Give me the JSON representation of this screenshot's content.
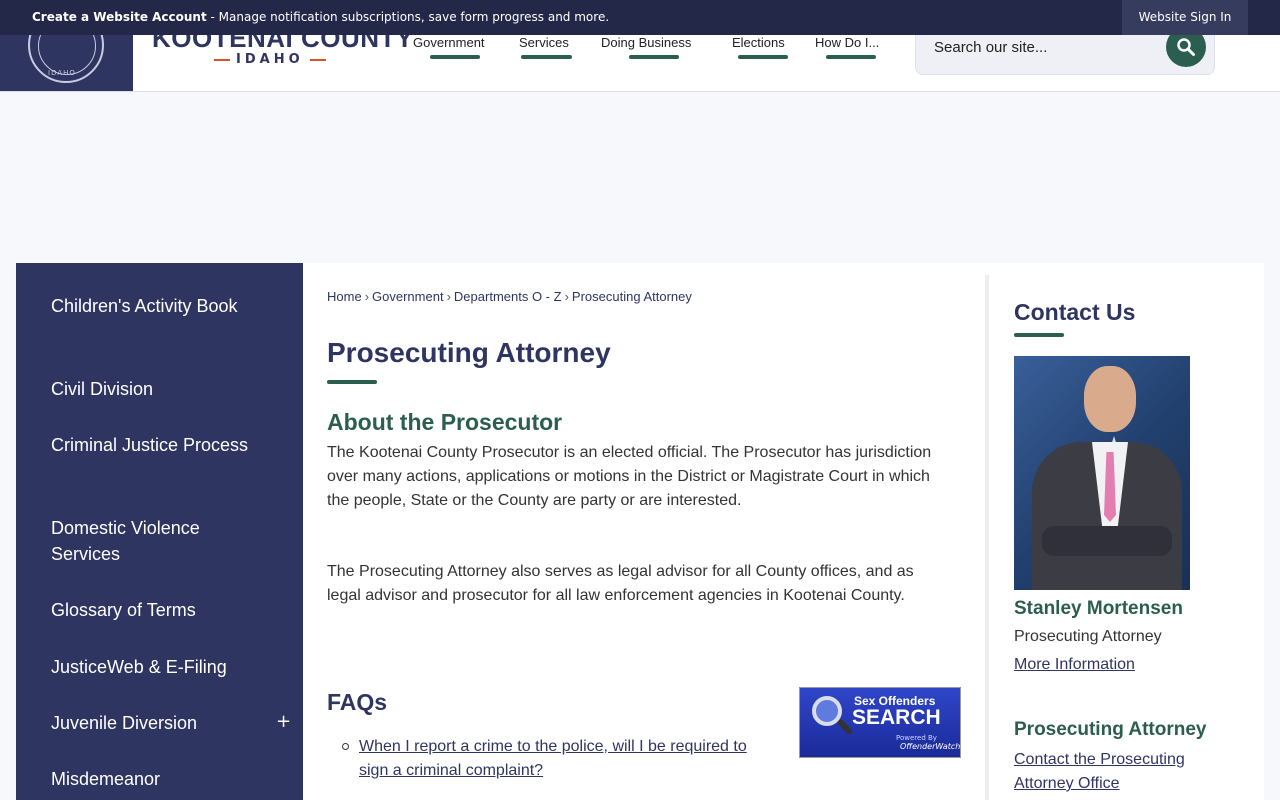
{
  "topbar": {
    "account_link": "Create a Website Account",
    "account_desc": " - Manage notification subscriptions, save form progress and more.",
    "signin_label": "Website Sign In"
  },
  "header": {
    "seal_text": "IDAHO",
    "logo_title": "KOOTENAI COUNTY",
    "logo_subtitle": "IDAHO",
    "nav": [
      {
        "label": "Government"
      },
      {
        "label": "Services"
      },
      {
        "label": "Doing Business"
      },
      {
        "label": "Elections"
      },
      {
        "label": "How Do I..."
      }
    ],
    "search_placeholder": "Search our site..."
  },
  "sidebar": {
    "items": [
      {
        "label": "Children's Activity Book"
      },
      {
        "label": "Civil Division"
      },
      {
        "label": "Criminal Justice Process"
      },
      {
        "label": "Domestic Violence Services"
      },
      {
        "label": "Glossary of Terms"
      },
      {
        "label": "JusticeWeb & E-Filing"
      },
      {
        "label": "Juvenile Diversion",
        "expander": "+"
      },
      {
        "label": "Misdemeanor"
      }
    ]
  },
  "breadcrumb": {
    "items": [
      "Home",
      "Government",
      "Departments O - Z",
      "Prosecuting Attorney"
    ],
    "separator": "›"
  },
  "main": {
    "title": "Prosecuting Attorney",
    "about_heading": "About the Prosecutor",
    "para1": "The Kootenai County Prosecutor is an elected official. The Prosecutor has jurisdiction over many actions, applications or motions in the District or Magistrate Court in which the people, State or the County are party or are interested.",
    "para2": "The Prosecuting Attorney also serves as legal advisor for all County offices, and as legal advisor and prosecutor for all law enforcement agencies in Kootenai County.",
    "faq_heading": "FAQs",
    "faq_items": [
      "When I report a crime to the police, will I be required to sign a criminal complaint?"
    ],
    "banner": {
      "line1": "Sex Offenders",
      "line2": "SEARCH",
      "line3": "Powered By",
      "line4": "OffenderWatch"
    }
  },
  "contact": {
    "heading": "Contact Us",
    "name": "Stanley Mortensen",
    "role": "Prosecuting Attorney",
    "more_info": "More Information",
    "office_heading": "Prosecuting Attorney",
    "office_link": "Contact the Prosecuting Attorney Office"
  },
  "colors": {
    "navy": "#2f3561",
    "green": "#2c5e50",
    "topbar": "#232848"
  }
}
